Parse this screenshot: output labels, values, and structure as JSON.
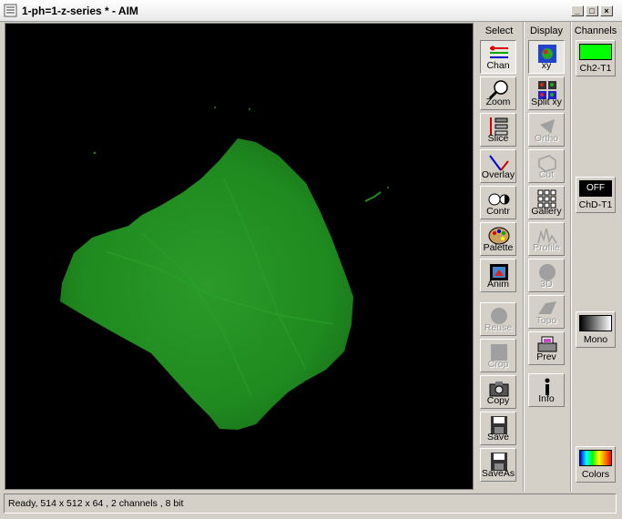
{
  "window": {
    "title": "1-ph=1-z-series * - AIM"
  },
  "columns": {
    "select": "Select",
    "display": "Display",
    "channels": "Channels"
  },
  "select_tools": [
    {
      "label": "Chan",
      "icon": "channel-icon",
      "enabled": true,
      "active": true
    },
    {
      "label": "Zoom",
      "icon": "magnifier-icon",
      "enabled": true
    },
    {
      "label": "Slice",
      "icon": "slice-icon",
      "enabled": true
    },
    {
      "label": "Overlay",
      "icon": "overlay-icon",
      "enabled": true
    },
    {
      "label": "Contr",
      "icon": "contrast-icon",
      "enabled": true
    },
    {
      "label": "Palette",
      "icon": "palette-icon",
      "enabled": true
    },
    {
      "label": "Anim",
      "icon": "animation-icon",
      "enabled": true
    },
    {
      "label": "Reuse",
      "icon": "reuse-icon",
      "enabled": false
    },
    {
      "label": "Crop",
      "icon": "crop-icon",
      "enabled": false
    },
    {
      "label": "Copy",
      "icon": "camera-icon",
      "enabled": true
    },
    {
      "label": "Save",
      "icon": "floppy-icon",
      "enabled": true
    },
    {
      "label": "SaveAs",
      "icon": "save-as-icon",
      "enabled": true
    }
  ],
  "display_tools": [
    {
      "label": "xy",
      "icon": "xy-icon",
      "enabled": true,
      "active": true
    },
    {
      "label": "Split xy",
      "icon": "split-xy-icon",
      "enabled": true
    },
    {
      "label": "Ortho",
      "icon": "ortho-icon",
      "enabled": false
    },
    {
      "label": "Cut",
      "icon": "cut-icon",
      "enabled": false
    },
    {
      "label": "Gallery",
      "icon": "gallery-icon",
      "enabled": true
    },
    {
      "label": "Profile",
      "icon": "profile-icon",
      "enabled": false
    },
    {
      "label": "3D",
      "icon": "3d-icon",
      "enabled": false
    },
    {
      "label": "Topo",
      "icon": "topo-icon",
      "enabled": false
    },
    {
      "label": "Prev",
      "icon": "printer-icon",
      "enabled": true
    },
    {
      "label": "Info",
      "icon": "info-icon",
      "enabled": true
    }
  ],
  "channels": [
    {
      "label": "Ch2-T1",
      "swatch": "#00ff00",
      "swatch_text": ""
    },
    {
      "label": "ChD-T1",
      "swatch": "#000000",
      "swatch_text": "OFF"
    },
    {
      "label": "Mono",
      "swatch": "gray-gradient",
      "swatch_text": ""
    },
    {
      "label": "Colors",
      "swatch": "rainbow-gradient",
      "swatch_text": ""
    }
  ],
  "status": {
    "text": "Ready, 514 x 512 x 64 , 2 channels , 8 bit"
  },
  "colors": {
    "specimen": "#1f8a1f",
    "background": "#000000",
    "face": "#d4d0c8"
  }
}
